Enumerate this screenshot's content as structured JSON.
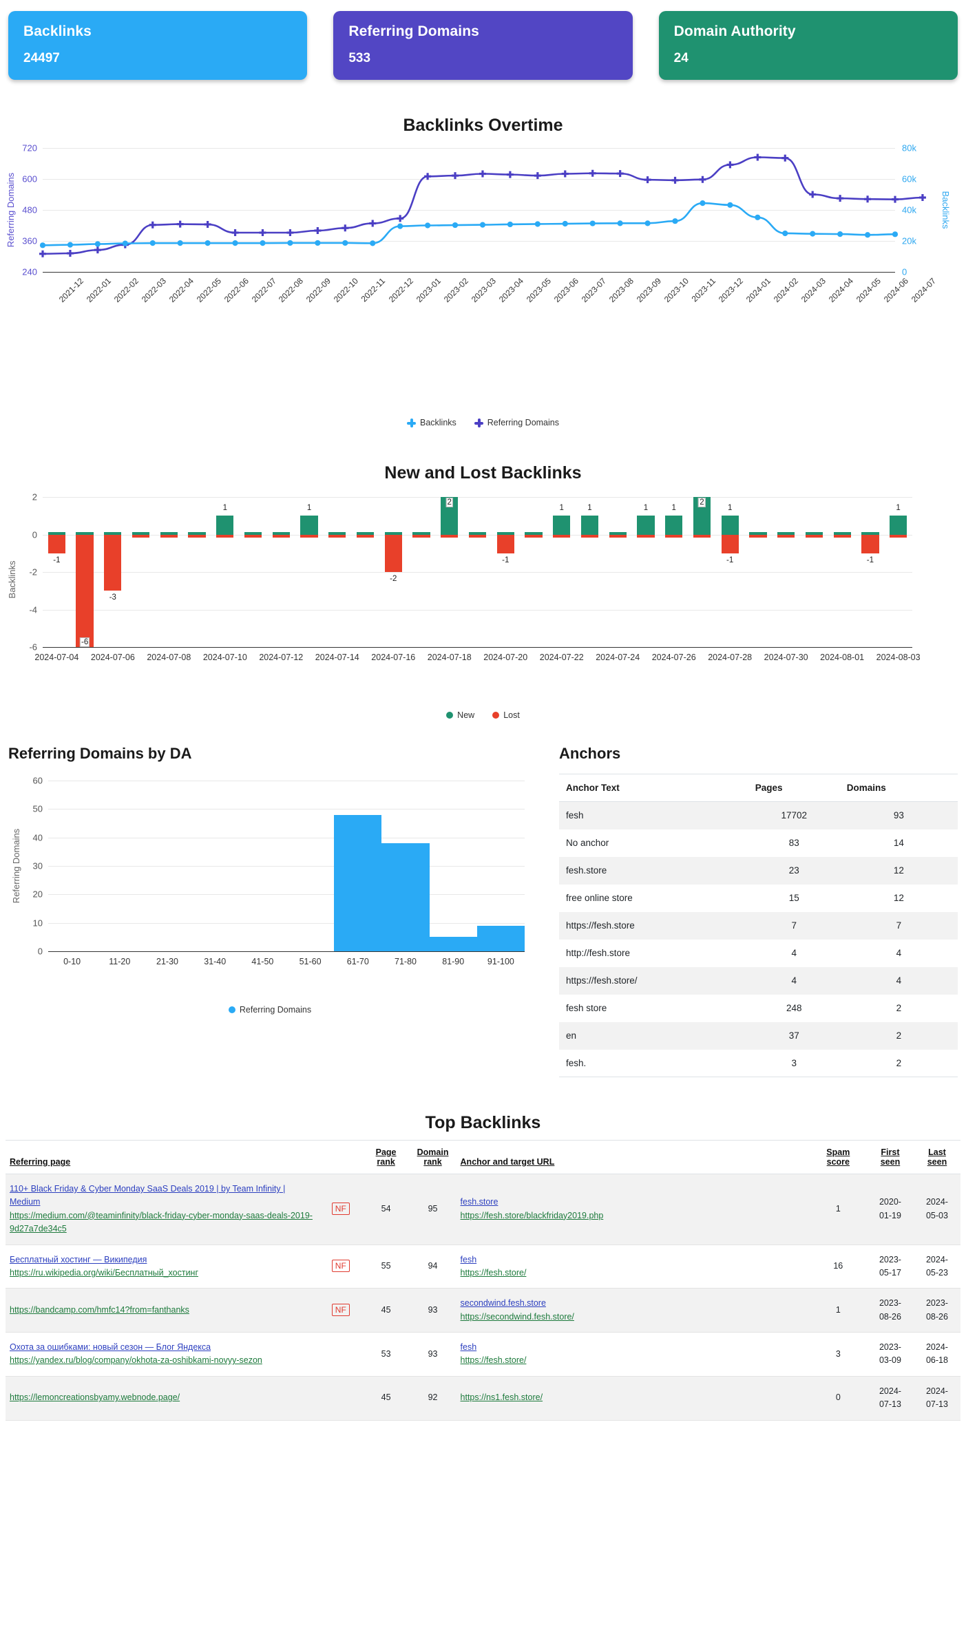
{
  "kpis": [
    {
      "label": "Backlinks",
      "value": "24497",
      "color": "#2aaaf5"
    },
    {
      "label": "Referring Domains",
      "value": "533",
      "color": "#5246c4"
    },
    {
      "label": "Domain Authority",
      "value": "24",
      "color": "#1f9270"
    }
  ],
  "chart_data": [
    {
      "type": "line",
      "title": "Backlinks Overtime",
      "xlabel": "",
      "ylabel_left": "Referring Domains",
      "ylabel_right": "Backlinks",
      "grid": true,
      "legend_position": "bottom",
      "ylim_left": [
        240,
        720
      ],
      "ylim_right": [
        0,
        80000
      ],
      "yticks_left": [
        "240",
        "360",
        "480",
        "600",
        "720"
      ],
      "yticks_right": [
        "0",
        "20k",
        "40k",
        "60k",
        "80k"
      ],
      "categories": [
        "2021-12",
        "2022-01",
        "2022-02",
        "2022-03",
        "2022-04",
        "2022-05",
        "2022-06",
        "2022-07",
        "2022-08",
        "2022-09",
        "2022-10",
        "2022-11",
        "2022-12",
        "2023-01",
        "2023-02",
        "2023-03",
        "2023-04",
        "2023-05",
        "2023-06",
        "2023-07",
        "2023-08",
        "2023-09",
        "2023-10",
        "2023-11",
        "2023-12",
        "2024-01",
        "2024-02",
        "2024-03",
        "2024-04",
        "2024-05",
        "2024-06",
        "2024-07"
      ],
      "series": [
        {
          "name": "Referring Domains",
          "color": "#4b3fc4",
          "axis": "left",
          "values": [
            310,
            312,
            325,
            345,
            422,
            425,
            424,
            392,
            392,
            392,
            400,
            410,
            428,
            447,
            610,
            613,
            620,
            617,
            613,
            620,
            622,
            621,
            597,
            595,
            598,
            655,
            684,
            681,
            540,
            525,
            522,
            521,
            528
          ]
        },
        {
          "name": "Backlinks",
          "color": "#2aaaf5",
          "axis": "right",
          "values": [
            17200,
            17500,
            18000,
            18400,
            18600,
            18600,
            18600,
            18600,
            18600,
            18700,
            18700,
            18700,
            18500,
            29500,
            30000,
            30200,
            30400,
            30700,
            30900,
            31100,
            31300,
            31400,
            31400,
            32800,
            44400,
            43200,
            35200,
            24900,
            24600,
            24400,
            23900,
            24300
          ]
        }
      ]
    },
    {
      "type": "bar",
      "title": "New and Lost Backlinks",
      "ylabel": "Backlinks",
      "xlabel": "",
      "grid": true,
      "legend_position": "bottom",
      "ylim": [
        -6,
        2
      ],
      "yticks": [
        "2",
        "0",
        "-2",
        "-4",
        "-6"
      ],
      "xticks": [
        "2024-07-04",
        "2024-07-06",
        "2024-07-08",
        "2024-07-10",
        "2024-07-12",
        "2024-07-14",
        "2024-07-16",
        "2024-07-18",
        "2024-07-20",
        "2024-07-22",
        "2024-07-24",
        "2024-07-26",
        "2024-07-28",
        "2024-07-30",
        "2024-08-01",
        "2024-08-03"
      ],
      "dates": [
        "2024-07-04",
        "2024-07-05",
        "2024-07-06",
        "2024-07-07",
        "2024-07-08",
        "2024-07-09",
        "2024-07-10",
        "2024-07-11",
        "2024-07-12",
        "2024-07-13",
        "2024-07-14",
        "2024-07-15",
        "2024-07-16",
        "2024-07-17",
        "2024-07-18",
        "2024-07-19",
        "2024-07-20",
        "2024-07-21",
        "2024-07-22",
        "2024-07-23",
        "2024-07-24",
        "2024-07-25",
        "2024-07-26",
        "2024-07-27",
        "2024-07-28",
        "2024-07-29",
        "2024-07-30",
        "2024-07-31",
        "2024-08-01",
        "2024-08-02",
        "2024-08-03"
      ],
      "series": [
        {
          "name": "New",
          "color": "#1f9270",
          "values": [
            0,
            0,
            0,
            0,
            0,
            0,
            1,
            0,
            0,
            1,
            0,
            0,
            0,
            0,
            2,
            0,
            0,
            0,
            1,
            1,
            0,
            1,
            1,
            2,
            1,
            0,
            0,
            0,
            0,
            0,
            1
          ]
        },
        {
          "name": "Lost",
          "color": "#e8402a",
          "values": [
            -1,
            -6,
            -3,
            0,
            0,
            0,
            0,
            0,
            0,
            0,
            0,
            0,
            -2,
            0,
            0,
            0,
            -1,
            0,
            0,
            0,
            0,
            0,
            0,
            0,
            -1,
            0,
            0,
            0,
            0,
            -1,
            0
          ]
        }
      ],
      "point_labels": [
        {
          "index": 0,
          "text": "-1",
          "kind": "neg"
        },
        {
          "index": 1,
          "text": "-6",
          "kind": "neg-inside"
        },
        {
          "index": 2,
          "text": "-3",
          "kind": "neg"
        },
        {
          "index": 6,
          "text": "1",
          "kind": "pos"
        },
        {
          "index": 9,
          "text": "1",
          "kind": "pos"
        },
        {
          "index": 12,
          "text": "-2",
          "kind": "neg"
        },
        {
          "index": 14,
          "text": "2",
          "kind": "pos-inside"
        },
        {
          "index": 16,
          "text": "-1",
          "kind": "neg"
        },
        {
          "index": 18,
          "text": "1",
          "kind": "pos"
        },
        {
          "index": 19,
          "text": "1",
          "kind": "pos"
        },
        {
          "index": 21,
          "text": "1",
          "kind": "pos"
        },
        {
          "index": 22,
          "text": "1",
          "kind": "pos"
        },
        {
          "index": 23,
          "text": "2",
          "kind": "pos-inside"
        },
        {
          "index": 24,
          "text": "1",
          "kind": "pos"
        },
        {
          "index": 24,
          "text": "-1",
          "kind": "neg"
        },
        {
          "index": 29,
          "text": "-1",
          "kind": "neg"
        },
        {
          "index": 30,
          "text": "1",
          "kind": "pos"
        }
      ]
    },
    {
      "type": "bar",
      "title": "Referring Domains by DA",
      "ylabel": "Referring Domains",
      "xlabel": "",
      "grid": true,
      "legend_position": "bottom",
      "ylim": [
        0,
        60
      ],
      "yticks": [
        "0",
        "10",
        "20",
        "30",
        "40",
        "50",
        "60"
      ],
      "categories": [
        "0-10",
        "11-20",
        "21-30",
        "31-40",
        "41-50",
        "51-60",
        "61-70",
        "71-80",
        "81-90",
        "91-100"
      ],
      "series": [
        {
          "name": "Referring Domains",
          "color": "#2aaaf5",
          "values": [
            0,
            0,
            0,
            0,
            0,
            0,
            48,
            38,
            5,
            9
          ]
        }
      ]
    }
  ],
  "anchors": {
    "title": "Anchors",
    "columns": [
      "Anchor Text",
      "Pages",
      "Domains"
    ],
    "rows": [
      {
        "anchor": "fesh",
        "pages": "17702",
        "domains": "93"
      },
      {
        "anchor": "No anchor",
        "pages": "83",
        "domains": "14"
      },
      {
        "anchor": "fesh.store",
        "pages": "23",
        "domains": "12"
      },
      {
        "anchor": "free online store",
        "pages": "15",
        "domains": "12"
      },
      {
        "anchor": "https://fesh.store",
        "pages": "7",
        "domains": "7"
      },
      {
        "anchor": "http://fesh.store",
        "pages": "4",
        "domains": "4"
      },
      {
        "anchor": "https://fesh.store/",
        "pages": "4",
        "domains": "4"
      },
      {
        "anchor": "fesh store",
        "pages": "248",
        "domains": "2"
      },
      {
        "anchor": "en",
        "pages": "37",
        "domains": "2"
      },
      {
        "anchor": "fesh.",
        "pages": "3",
        "domains": "2"
      }
    ]
  },
  "top_backlinks": {
    "title": "Top Backlinks",
    "columns": {
      "referring_page": "Referring page",
      "page_rank": "Page rank",
      "page_rank_l1": "Page",
      "page_rank_l2": "rank",
      "domain_rank_l1": "Domain",
      "domain_rank_l2": "rank",
      "anchor_url": "Anchor and target URL",
      "spam_l1": "Spam",
      "spam_l2": "score",
      "first_l1": "First",
      "first_l2": "seen",
      "last_l1": "Last",
      "last_l2": "seen"
    },
    "rows": [
      {
        "page_title": "110+ Black Friday & Cyber Monday SaaS Deals 2019 | by Team Infinity | Medium",
        "page_url": "https://medium.com/@teaminfinity/black-friday-cyber-monday-saas-deals-2019-9d27a7de34c5",
        "nofollow": "NF",
        "page_rank": "54",
        "domain_rank": "95",
        "anchor_text": "fesh.store",
        "target_url": "https://fesh.store/blackfriday2019.php",
        "spam_score": "1",
        "first_seen": "2020-01-19",
        "last_seen": "2024-05-03"
      },
      {
        "page_title": "Бесплатный хостинг — Википедия",
        "page_url": "https://ru.wikipedia.org/wiki/Бесплатный_хостинг",
        "nofollow": "NF",
        "page_rank": "55",
        "domain_rank": "94",
        "anchor_text": "fesh",
        "target_url": "https://fesh.store/",
        "spam_score": "16",
        "first_seen": "2023-05-17",
        "last_seen": "2024-05-23"
      },
      {
        "page_title": "",
        "page_url": "https://bandcamp.com/hmfc14?from=fanthanks",
        "nofollow": "NF",
        "page_rank": "45",
        "domain_rank": "93",
        "anchor_text": "secondwind.fesh.store",
        "target_url": "https://secondwind.fesh.store/",
        "spam_score": "1",
        "first_seen": "2023-08-26",
        "last_seen": "2023-08-26"
      },
      {
        "page_title": "Охота за ошибками: новый сезон — Блог Яндекса",
        "page_url": "https://yandex.ru/blog/company/okhota-za-oshibkami-novyy-sezon",
        "nofollow": "",
        "page_rank": "53",
        "domain_rank": "93",
        "anchor_text": "fesh",
        "target_url": "https://fesh.store/",
        "spam_score": "3",
        "first_seen": "2023-03-09",
        "last_seen": "2024-06-18"
      },
      {
        "page_title": "",
        "page_url": "https://lemoncreationsbyamy.webnode.page/",
        "nofollow": "",
        "page_rank": "45",
        "domain_rank": "92",
        "anchor_text": "",
        "target_url": "https://ns1.fesh.store/",
        "spam_score": "0",
        "first_seen": "2024-07-13",
        "last_seen": "2024-07-13"
      }
    ]
  }
}
